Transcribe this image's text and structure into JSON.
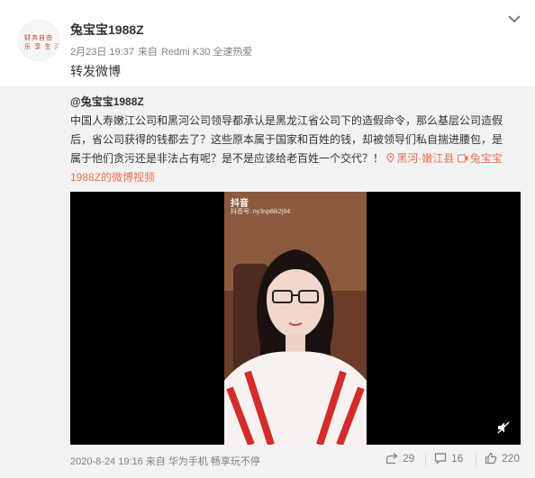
{
  "post": {
    "username": "兔宝宝1988Z",
    "date": "2月23日 19:37",
    "source_prefix": "来自",
    "device": "Redmi K30 全速热爱",
    "text": "转发微博",
    "avatar_text_1": "财务自由",
    "avatar_text_2": "乐 享 生 活"
  },
  "original": {
    "username": "@兔宝宝1988Z",
    "body": "中国人寿嫩江公司和黑河公司领导都承认是黑龙江省公司下的造假命令，那么基层公司造假后，省公司获得的钱都去了？这些原本属于国家和百姓的钱，却被领导们私自揣进腰包，是属于他们贪污还是非法占有呢？是不是应该给老百姓一个交代？！",
    "location": "黑河·嫩江县",
    "video_link": "兔宝宝1988Z的微博视频",
    "video": {
      "watermark": "抖音",
      "watermark_id": "抖音号: ny3np8ik2j94"
    }
  },
  "footer": {
    "timestamp": "2020-8-24 19:16 来自 华为手机 畅享玩不停",
    "reposts": "29",
    "comments": "16",
    "likes": "220"
  }
}
